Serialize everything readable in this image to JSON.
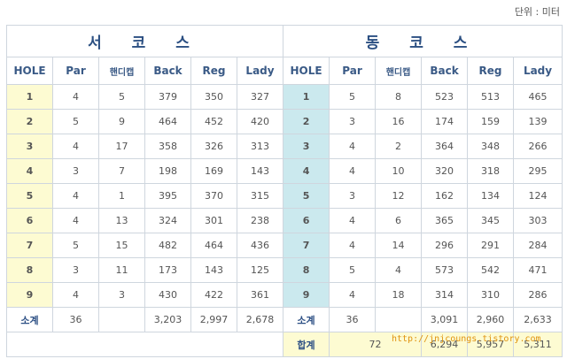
{
  "unit_label": "단위 : 미터",
  "west": {
    "title": "서 코 스",
    "rows": [
      {
        "hole": "1",
        "par": "4",
        "hdcp": "5",
        "back": "379",
        "reg": "350",
        "lady": "327"
      },
      {
        "hole": "2",
        "par": "5",
        "hdcp": "9",
        "back": "464",
        "reg": "452",
        "lady": "420"
      },
      {
        "hole": "3",
        "par": "4",
        "hdcp": "17",
        "back": "358",
        "reg": "326",
        "lady": "313"
      },
      {
        "hole": "4",
        "par": "3",
        "hdcp": "7",
        "back": "198",
        "reg": "169",
        "lady": "143"
      },
      {
        "hole": "5",
        "par": "4",
        "hdcp": "1",
        "back": "395",
        "reg": "370",
        "lady": "315"
      },
      {
        "hole": "6",
        "par": "4",
        "hdcp": "13",
        "back": "324",
        "reg": "301",
        "lady": "238"
      },
      {
        "hole": "7",
        "par": "5",
        "hdcp": "15",
        "back": "482",
        "reg": "464",
        "lady": "436"
      },
      {
        "hole": "8",
        "par": "3",
        "hdcp": "11",
        "back": "173",
        "reg": "143",
        "lady": "125"
      },
      {
        "hole": "9",
        "par": "4",
        "hdcp": "3",
        "back": "430",
        "reg": "422",
        "lady": "361"
      }
    ],
    "subtotal": {
      "label": "소계",
      "par": "36",
      "hdcp": "",
      "back": "3,203",
      "reg": "2,997",
      "lady": "2,678"
    }
  },
  "east": {
    "title": "동 코 스",
    "rows": [
      {
        "hole": "1",
        "par": "5",
        "hdcp": "8",
        "back": "523",
        "reg": "513",
        "lady": "465"
      },
      {
        "hole": "2",
        "par": "3",
        "hdcp": "16",
        "back": "174",
        "reg": "159",
        "lady": "139"
      },
      {
        "hole": "3",
        "par": "4",
        "hdcp": "2",
        "back": "364",
        "reg": "348",
        "lady": "266"
      },
      {
        "hole": "4",
        "par": "4",
        "hdcp": "10",
        "back": "320",
        "reg": "318",
        "lady": "295"
      },
      {
        "hole": "5",
        "par": "3",
        "hdcp": "12",
        "back": "162",
        "reg": "134",
        "lady": "124"
      },
      {
        "hole": "6",
        "par": "4",
        "hdcp": "6",
        "back": "365",
        "reg": "345",
        "lady": "303"
      },
      {
        "hole": "7",
        "par": "4",
        "hdcp": "14",
        "back": "296",
        "reg": "291",
        "lady": "284"
      },
      {
        "hole": "8",
        "par": "5",
        "hdcp": "4",
        "back": "573",
        "reg": "542",
        "lady": "471"
      },
      {
        "hole": "9",
        "par": "4",
        "hdcp": "18",
        "back": "314",
        "reg": "310",
        "lady": "286"
      }
    ],
    "subtotal": {
      "label": "소계",
      "par": "36",
      "hdcp": "",
      "back": "3,091",
      "reg": "2,960",
      "lady": "2,633"
    }
  },
  "headers": {
    "hole": "HOLE",
    "par": "Par",
    "hdcp": "핸디캡",
    "back": "Back",
    "reg": "Reg",
    "lady": "Lady"
  },
  "total": {
    "label": "합계",
    "par": "72",
    "back": "6,294",
    "reg": "5,957",
    "lady": "5,311"
  },
  "watermark": "http://jnjcoungs.tistory.com"
}
